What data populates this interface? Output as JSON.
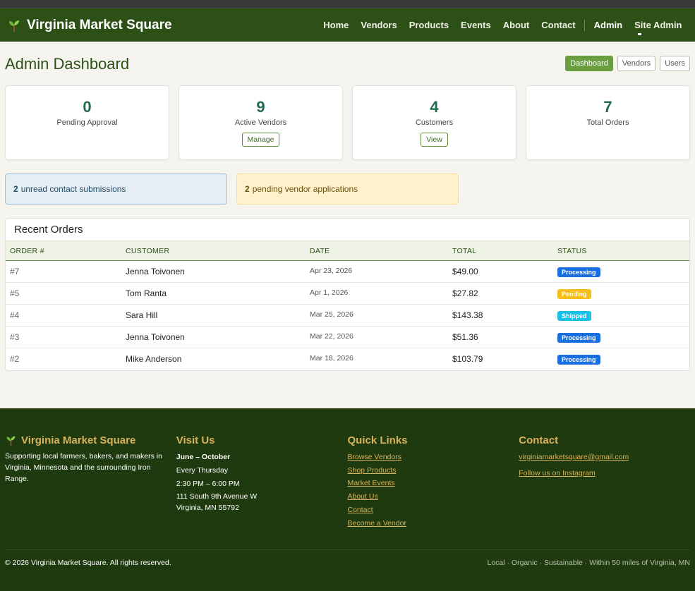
{
  "nav": {
    "brand": "Virginia Market Square",
    "links": [
      "Home",
      "Vendors",
      "Products",
      "Events",
      "About",
      "Contact"
    ],
    "admin": "Admin",
    "site_admin": "Site Admin"
  },
  "page": {
    "title": "Admin Dashboard",
    "tabs": [
      "Dashboard",
      "Vendors",
      "Users"
    ],
    "active_tab": "Dashboard"
  },
  "stats": [
    {
      "value": "0",
      "label": "Pending Approval",
      "action": ""
    },
    {
      "value": "9",
      "label": "Active Vendors",
      "action": "Manage"
    },
    {
      "value": "4",
      "label": "Customers",
      "action": "View"
    },
    {
      "value": "7",
      "label": "Total Orders",
      "action": ""
    }
  ],
  "alerts": {
    "contact": {
      "count": "2",
      "text": "unread contact submissions"
    },
    "vendor": {
      "count": "2",
      "text": "pending vendor applications"
    }
  },
  "orders": {
    "title": "Recent Orders",
    "columns": [
      "ORDER #",
      "CUSTOMER",
      "DATE",
      "TOTAL",
      "STATUS"
    ],
    "rows": [
      {
        "id": "#7",
        "customer": "Jenna Toivonen",
        "date": "Apr 23, 2026",
        "total": "$49.00",
        "status": "Processing"
      },
      {
        "id": "#5",
        "customer": "Tom Ranta",
        "date": "Apr 1, 2026",
        "total": "$27.82",
        "status": "Pending"
      },
      {
        "id": "#4",
        "customer": "Sara Hill",
        "date": "Mar 25, 2026",
        "total": "$143.38",
        "status": "Shipped"
      },
      {
        "id": "#3",
        "customer": "Jenna Toivonen",
        "date": "Mar 22, 2026",
        "total": "$51.36",
        "status": "Processing"
      },
      {
        "id": "#2",
        "customer": "Mike Anderson",
        "date": "Mar 18, 2026",
        "total": "$103.79",
        "status": "Processing"
      }
    ],
    "status_colors": {
      "Processing": "#1a6fe0",
      "Pending": "#f5be18",
      "Shipped": "#18bfe6"
    }
  },
  "footer": {
    "brand": "Virginia Market Square",
    "about": "Supporting local farmers, bakers, and makers in Virginia, Minnesota and the surrounding Iron Range.",
    "visit": {
      "heading": "Visit Us",
      "season": "June – October",
      "day": "Every Thursday",
      "hours": "2:30 PM – 6:00 PM",
      "street": "111 South 9th Avenue W",
      "city": "Virginia, MN 55792"
    },
    "quick_links": {
      "heading": "Quick Links",
      "items": [
        "Browse Vendors",
        "Shop Products",
        "Market Events",
        "About Us",
        "Contact",
        "Become a Vendor"
      ]
    },
    "contact": {
      "heading": "Contact",
      "email": "virginiamarketsquare@gmail.com",
      "instagram": "Follow us on Instagram"
    },
    "copyright": "© 2026 Virginia Market Square. All rights reserved.",
    "tagline": "Local · Organic · Sustainable · Within 50 miles of Virginia, MN"
  },
  "colors": {
    "nav_bg": "#2c5016",
    "footer_bg": "#1e3a0e",
    "accent_gold": "#d9b25c",
    "stat_number": "#1f6b4a",
    "active_tab": "#6a9e40"
  }
}
